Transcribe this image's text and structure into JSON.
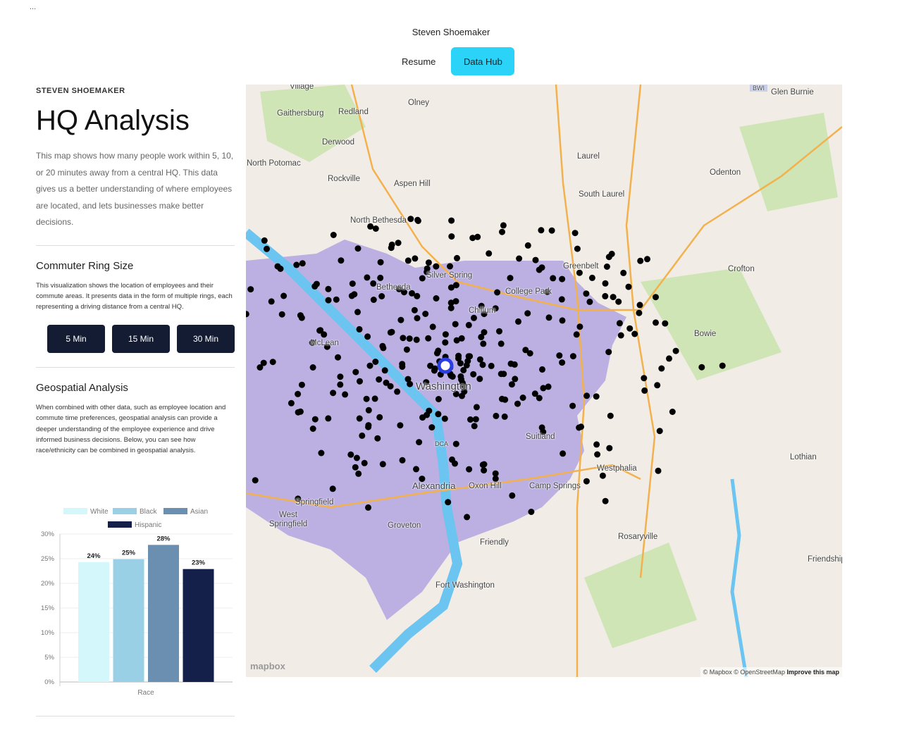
{
  "header": {
    "menu": "...",
    "site_name": "Steven Shoemaker",
    "nav": [
      "Resume",
      "Data Hub"
    ]
  },
  "sidebar": {
    "eyebrow": "STEVEN SHOEMAKER",
    "title": "HQ Analysis",
    "intro": "This map shows how many people work within 5, 10, or 20 minutes away from a central HQ. This data gives us a better understanding of where employees are located, and lets businesses make better decisions.",
    "ring": {
      "title": "Commuter Ring Size",
      "text": "This visualization shows the location of employees and their commute areas. It presents data in the form of multiple rings, each representing a driving distance from a central HQ.",
      "buttons": [
        "5 Min",
        "15 Min",
        "30 Min"
      ]
    },
    "geo": {
      "title": "Geospatial Analysis",
      "text": "When combined with other data, such as employee location and commute time preferences, geospatial analysis can provide a deeper understanding of the employee experience and drive informed business decisions. Below, you can see how race/ethnicity can be combined in geospatial analysis."
    }
  },
  "chart_data": {
    "type": "bar",
    "xlabel": "Race",
    "categories": [
      "Race"
    ],
    "ylim": [
      0,
      30
    ],
    "yticks": [
      "0%",
      "5%",
      "10%",
      "15%",
      "20%",
      "25%",
      "30%"
    ],
    "series": [
      {
        "name": "White",
        "value": 24.3,
        "label": "24%",
        "color": "#d4f7fc"
      },
      {
        "name": "Black",
        "value": 24.9,
        "label": "25%",
        "color": "#9ad0e5"
      },
      {
        "name": "Asian",
        "value": 27.8,
        "label": "28%",
        "color": "#6a8fb0"
      },
      {
        "name": "Hispanic",
        "value": 22.9,
        "label": "23%",
        "color": "#141f4a"
      }
    ],
    "legend": "top"
  },
  "map": {
    "places": [
      "Village",
      "Olney",
      "Gaithersburg",
      "Redland",
      "Derwood",
      "North Potomac",
      "Rockville",
      "Aspen Hill",
      "Laurel",
      "South Laurel",
      "Odenton",
      "Glen Burnie",
      "North Bethesda",
      "Greenbelt",
      "Crofton",
      "Silver Spring",
      "Bethesda",
      "College Park",
      "Chillum",
      "Bowie",
      "McLean",
      "Washington",
      "Suitland",
      "Westphalia",
      "Alexandria",
      "Oxon Hill",
      "Camp Springs",
      "Springfield",
      "West Springfield",
      "Groveton",
      "Friendly",
      "Rosaryville",
      "Lothian",
      "Fort Washington",
      "Friendship",
      "BWI",
      "DCA"
    ],
    "logo": "mapbox",
    "attribution": "© Mapbox © OpenStreetMap",
    "improve": "Improve this map",
    "colors": {
      "isochrone": "#a99be0",
      "water": "#6cc4f0",
      "park": "#cfe5b5"
    }
  }
}
